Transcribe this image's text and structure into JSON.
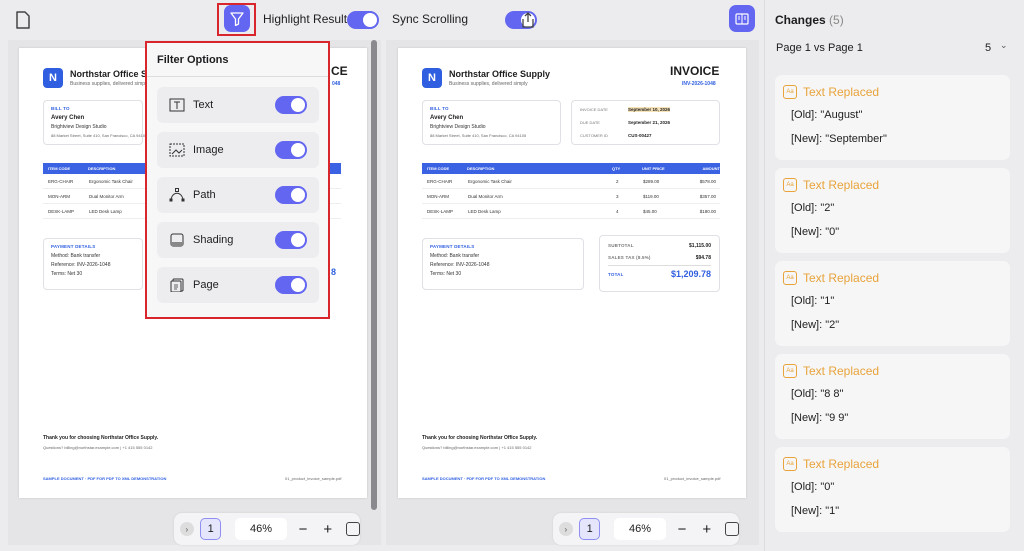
{
  "toolbar": {
    "highlight_label": "Highlight Result",
    "sync_label": "Sync Scrolling"
  },
  "filter": {
    "title": "Filter Options",
    "items": [
      {
        "label": "Text",
        "on": true
      },
      {
        "label": "Image",
        "on": true
      },
      {
        "label": "Path",
        "on": true
      },
      {
        "label": "Shading",
        "on": true
      },
      {
        "label": "Page",
        "on": true
      }
    ]
  },
  "invoice": {
    "company": "Northstar Office Supply",
    "tagline": "Business supplies, delivered simply",
    "logo_letter": "N",
    "title": "INVOICE",
    "number": "INV-2026-1048",
    "bill_to_label": "BILL TO",
    "client": "Avery Chen",
    "client_company": "Brightview Design Studio",
    "client_address": "88 Market Street, Suite 410, San Francisco, CA 94105",
    "meta": [
      {
        "k": "INVOICE DATE",
        "v": "September 10, 2026"
      },
      {
        "k": "DUE DATE",
        "v": "September 21, 2026"
      },
      {
        "k": "CUSTOMER ID",
        "v": "CUS-00427"
      }
    ],
    "table_headers": [
      "ITEM CODE",
      "DESCRIPTION",
      "QTY",
      "UNIT PRICE",
      "AMOUNT"
    ],
    "rows": [
      [
        "ERG-CHAIR",
        "Ergonomic Task Chair",
        "2",
        "$289.00",
        "$578.00"
      ],
      [
        "MON-ARM",
        "Dual Monitor Arm",
        "3",
        "$119.00",
        "$357.00"
      ],
      [
        "DESK-LAMP",
        "LED Desk Lamp",
        "4",
        "$45.00",
        "$180.00"
      ]
    ],
    "left_amounts": [
      "00",
      "00",
      "00"
    ],
    "payment_label": "PAYMENT DETAILS",
    "payment": [
      "Method: Bank transfer",
      "Reference: INV-2026-1048",
      "Terms: Net 30"
    ],
    "subtotal_label": "SUBTOTAL",
    "subtotal": "$1,115.00",
    "tax_label": "SALES TAX (8.5%)",
    "tax": "$94.78",
    "total_label": "TOTAL",
    "total": "$1,209.78",
    "thanks": "Thank you for choosing Northstar Office Supply.",
    "questions": "Questions? billing@northstar.example.com | +1 415 555 0142",
    "footer_left": "SAMPLE DOCUMENT · PDF FOR PDF TO XML DEMONSTRATION",
    "footer_right": "01_product_invoice_sample.pdf",
    "left_title_fragment": "CE",
    "left_number_fragment": "048",
    "left_total_fragment": "8"
  },
  "viewer": {
    "page": "1",
    "zoom": "46%",
    "left_page": "1",
    "right_page": "1"
  },
  "changes": {
    "title": "Changes",
    "count": "(5)",
    "compare": "Page 1 vs Page 1",
    "compare_count": "5",
    "items": [
      {
        "type": "Text Replaced",
        "old": "[Old]: \"August\"",
        "new": "[New]: \"September\""
      },
      {
        "type": "Text Replaced",
        "old": "[Old]: \"2\"",
        "new": "[New]: \"0\""
      },
      {
        "type": "Text Replaced",
        "old": "[Old]: \"1\"",
        "new": "[New]: \"2\""
      },
      {
        "type": "Text Replaced",
        "old": "[Old]: \"8 8\"",
        "new": "[New]: \"9 9\""
      },
      {
        "type": "Text Replaced",
        "old": "[Old]: \"0\"",
        "new": "[New]: \"1\""
      }
    ]
  },
  "colors": {
    "accent": "#6366f1",
    "highlight_red": "#d9262c",
    "change": "#e8a33a",
    "invoice_blue": "#2f5fe0"
  }
}
